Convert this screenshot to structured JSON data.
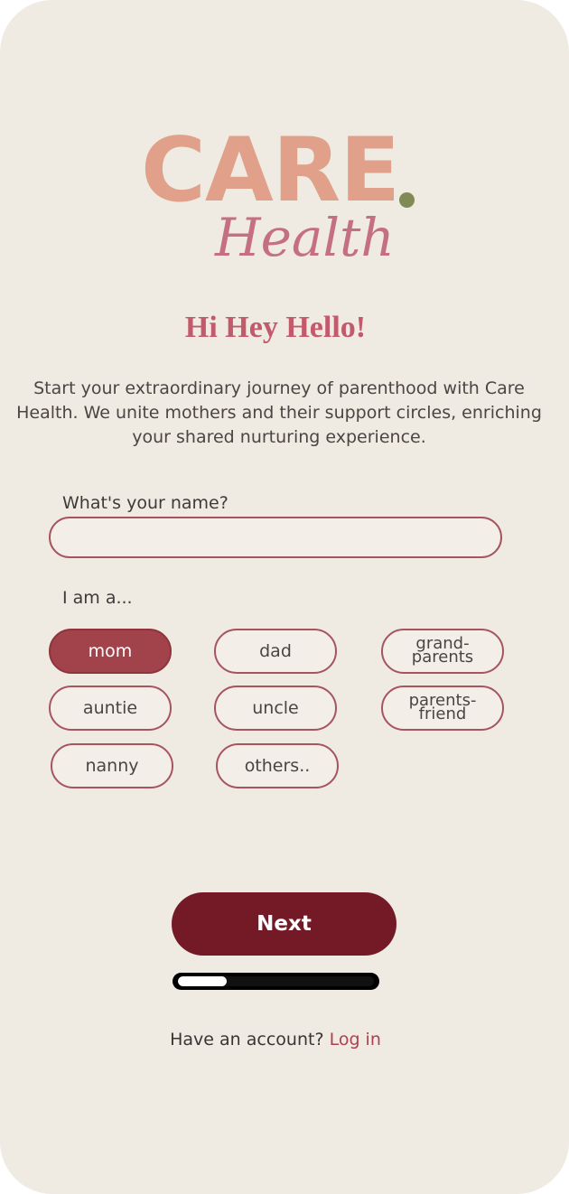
{
  "logo": {
    "brand": "CARE",
    "subtitle": "Health"
  },
  "greeting": "Hi Hey Hello!",
  "intro": "Start your extraordinary journey of parenthood with Care Health. We unite mothers and their support circles, enriching your shared nurturing experience.",
  "name_field": {
    "label": "What's your name?",
    "value": "",
    "placeholder": ""
  },
  "role_field": {
    "label": "I am a...",
    "options": [
      {
        "label": "mom",
        "selected": true
      },
      {
        "label": "dad",
        "selected": false
      },
      {
        "label": "grand-\nparents",
        "selected": false
      },
      {
        "label": "auntie",
        "selected": false
      },
      {
        "label": "uncle",
        "selected": false
      },
      {
        "label": "parents-\nfriend",
        "selected": false
      },
      {
        "label": "nanny",
        "selected": false
      },
      {
        "label": "others..",
        "selected": false
      }
    ]
  },
  "next_button": "Next",
  "progress": {
    "fraction": 0.25
  },
  "account": {
    "prompt": "Have an account?",
    "login_label": "Log in"
  },
  "colors": {
    "background": "#efeae2",
    "brand_peach": "#e0a08a",
    "brand_rose": "#c47080",
    "brand_dot_olive": "#7f8a56",
    "accent": "#741a27",
    "chip_selected": "#a2434b"
  }
}
